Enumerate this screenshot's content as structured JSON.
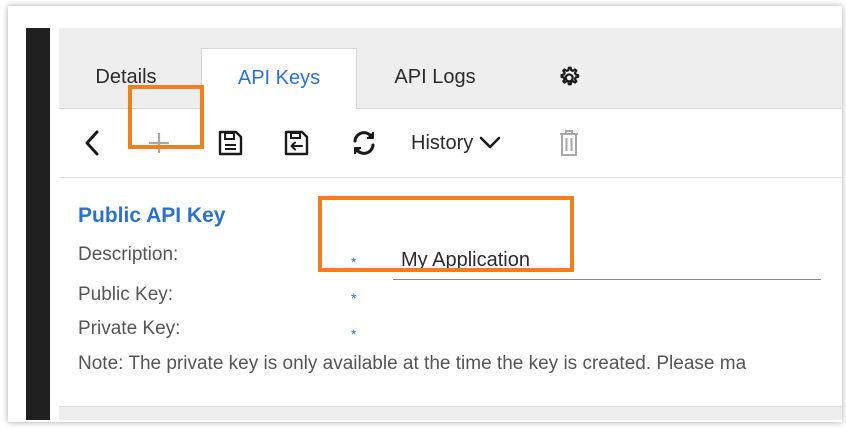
{
  "tabs": [
    {
      "label": "Details"
    },
    {
      "label": "API Keys",
      "active": true
    },
    {
      "label": "API Logs"
    }
  ],
  "tab_icons": {
    "settings": "gear-icon"
  },
  "toolbar": {
    "history_label": "History",
    "icons": [
      "back-arrow-icon",
      "add-icon",
      "save-icon",
      "save-as-icon",
      "refresh-icon",
      "chevron-down-icon",
      "trash-icon"
    ]
  },
  "form": {
    "section_title": "Public API Key",
    "description_label": "Description:",
    "public_key_label": "Public Key:",
    "private_key_label": "Private Key:",
    "required_marker": "*",
    "description_value": "My Application",
    "note": "Note: The private key is only available at the time the key is created. Please ma"
  },
  "colors": {
    "accent": "#2b73c5",
    "highlight": "#f07f1e",
    "sidebar": "#1f1f1f"
  }
}
